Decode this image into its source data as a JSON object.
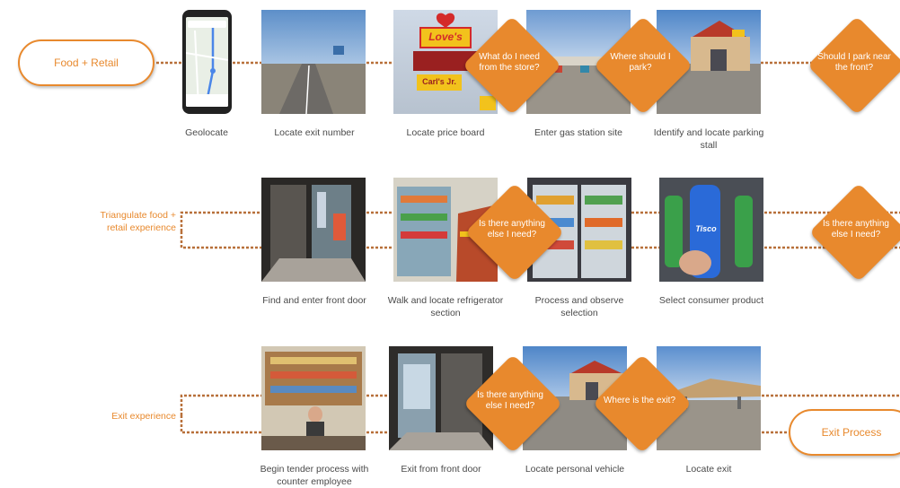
{
  "colors": {
    "accent": "#e8892d",
    "text": "#4a4a4a",
    "line": "#b8703a"
  },
  "start_pill": {
    "label": "Food + Retail"
  },
  "end_pill": {
    "label": "Exit Process"
  },
  "side_labels": {
    "row2": "Triangulate food + retail experience",
    "row3": "Exit experience"
  },
  "row1": {
    "steps": [
      "Geolocate",
      "Locate exit number",
      "Locate price board",
      "Enter gas station site",
      "Identify and locate parking stall"
    ],
    "questions": [
      "What do I need from the store?",
      "Where should I park?",
      "Should I park near the front?"
    ],
    "sign_text": [
      "Love's",
      "Carl's Jr."
    ]
  },
  "row2": {
    "steps": [
      "Find and enter front door",
      "Walk and locate refrigerator section",
      "Process and observe selection",
      "Select consumer product"
    ],
    "questions": [
      "Is there anything else I need?",
      "Is there anything else I need?"
    ],
    "product_text": "Tisco"
  },
  "row3": {
    "steps": [
      "Begin tender process with counter employee",
      "Exit from front door",
      "Locate personal vehicle",
      "Locate exit"
    ],
    "questions": [
      "Is there anything else I need?",
      "Where is the exit?"
    ]
  }
}
